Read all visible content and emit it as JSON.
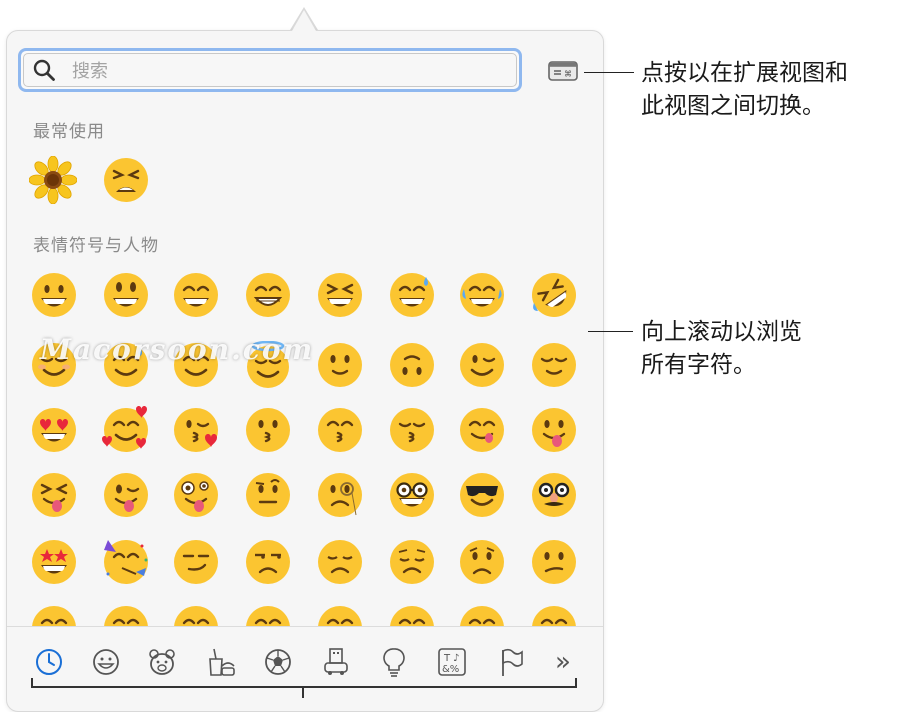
{
  "search": {
    "placeholder": "搜索"
  },
  "sections": {
    "recent": "最常使用",
    "smileys": "表情符号与人物"
  },
  "callouts": {
    "toggle_view": "点按以在扩展视图和\n此视图之间切换。",
    "scroll": "向上滚动以浏览\n所有字符。"
  },
  "watermark": "Macorsoon.com",
  "recent_emojis": [
    "sunflower",
    "tired-face"
  ],
  "emoji_rows": [
    [
      "grinning-face",
      "grinning-face-big-eyes",
      "grinning-face-smiling-eyes",
      "beaming-face",
      "squinting-face",
      "grinning-face-sweat",
      "face-tears-of-joy",
      "rolling-on-floor-laughing"
    ],
    [
      "smiling-face",
      "smiling-face-sweat",
      "smiling-face-smiling-eyes",
      "smiling-face-halo",
      "slightly-smiling-face",
      "upside-down-face",
      "winking-face",
      "relieved-face"
    ],
    [
      "heart-eyes",
      "smiling-face-hearts",
      "face-blowing-kiss",
      "kissing-face",
      "kissing-face-smiling-eyes",
      "kissing-face-closed-eyes",
      "face-savoring-food",
      "face-with-tongue"
    ],
    [
      "squinting-face-tongue",
      "winking-face-tongue",
      "zany-face",
      "face-raised-eyebrow",
      "face-with-monocle",
      "nerd-face",
      "smiling-face-sunglasses",
      "disguised-face"
    ],
    [
      "star-struck",
      "partying-face",
      "smirking-face",
      "unamused-face",
      "disappointed-face",
      "pensive-face",
      "worried-face",
      "confused-face"
    ]
  ],
  "categories": [
    {
      "name": "recent-clock-icon",
      "selected": true
    },
    {
      "name": "smiley-icon"
    },
    {
      "name": "animal-icon"
    },
    {
      "name": "food-icon"
    },
    {
      "name": "activity-icon"
    },
    {
      "name": "travel-icon"
    },
    {
      "name": "objects-icon"
    },
    {
      "name": "symbols-icon"
    },
    {
      "name": "flag-icon"
    }
  ],
  "more_label": "»",
  "colors": {
    "accent": "#1a6fd6",
    "emoji_yellow": "#fbc531",
    "search_focus": "#8fb8ef"
  }
}
